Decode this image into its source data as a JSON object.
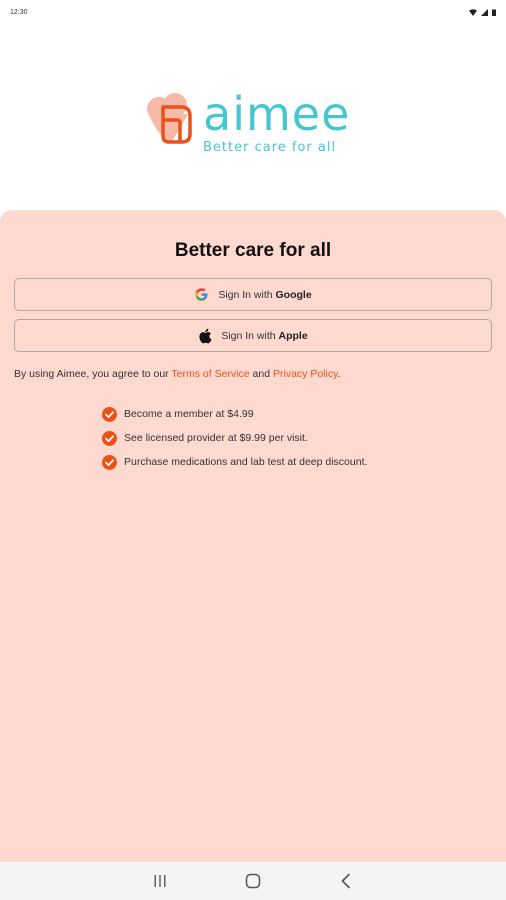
{
  "status_bar": {
    "time": "12:30"
  },
  "brand": {
    "name": "aimee",
    "tagline": "Better care for all",
    "primary_color": "#46c6d1",
    "accent_color": "#e8531c",
    "card_color": "#fed9cf"
  },
  "card": {
    "title": "Better care for all",
    "google_button": {
      "prefix": "Sign In with",
      "provider": "Google",
      "icon": "google-icon"
    },
    "apple_button": {
      "prefix": "Sign In with",
      "provider": "Apple",
      "icon": "apple-icon"
    },
    "terms": {
      "prefix": "By using Aimee, you agree to our",
      "terms_link": "Terms of Service",
      "connector": "and",
      "privacy_link": "Privacy Policy",
      "suffix": "."
    },
    "benefits": [
      "Become a member at $4.99",
      "See licensed provider at $9.99 per visit.",
      "Purchase medications and lab test at deep discount."
    ]
  },
  "nav_bar": {
    "icons": [
      "recent-apps-icon",
      "home-icon",
      "back-icon"
    ]
  }
}
